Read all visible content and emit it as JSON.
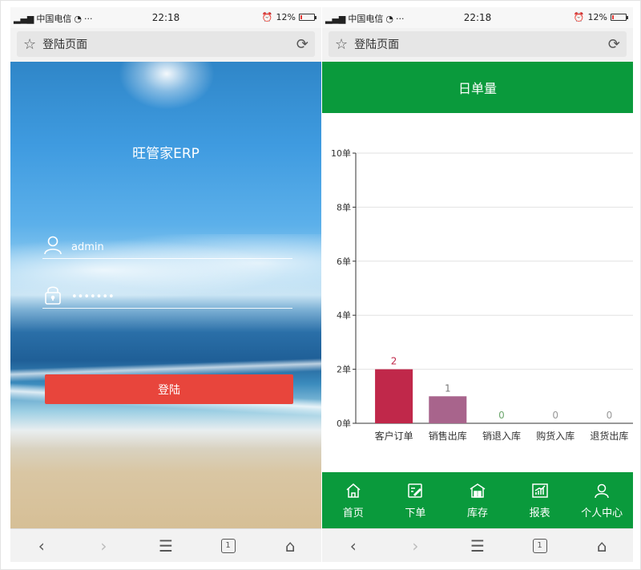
{
  "status_bar": {
    "carrier": "中国电信",
    "time": "22:18",
    "battery": "12%",
    "dots": "···"
  },
  "left_screen": {
    "url_title": "登陆页面",
    "app_title": "旺管家ERP",
    "username_value": "admin",
    "password_mask": "•••••••",
    "login_label": "登陆"
  },
  "right_screen": {
    "url_title": "登陆页面",
    "header_title": "日单量",
    "tabs": [
      {
        "label": "首页",
        "icon": "home-icon"
      },
      {
        "label": "下单",
        "icon": "edit-icon"
      },
      {
        "label": "库存",
        "icon": "warehouse-icon"
      },
      {
        "label": "报表",
        "icon": "chart-icon"
      },
      {
        "label": "个人中心",
        "icon": "user-icon"
      }
    ]
  },
  "nav": {
    "tab_count": "1"
  },
  "colors": {
    "accent_green": "#0a9a3c",
    "login_red": "#e8453c"
  },
  "chart_data": {
    "type": "bar",
    "title": "",
    "categories": [
      "客户订单",
      "销售出库",
      "销退入库",
      "购货入库",
      "退货出库"
    ],
    "values": [
      2,
      1,
      0,
      0,
      0
    ],
    "bar_colors": [
      "#c0284a",
      "#a8648c",
      "#6fa86f",
      "#999999",
      "#999999"
    ],
    "label_colors": [
      "#c0284a",
      "#777777",
      "#6fa86f",
      "#999999",
      "#999999"
    ],
    "y_ticks": [
      "0单",
      "2单",
      "4单",
      "6单",
      "8单",
      "10单"
    ],
    "ylim": [
      0,
      10
    ],
    "grid": true
  }
}
